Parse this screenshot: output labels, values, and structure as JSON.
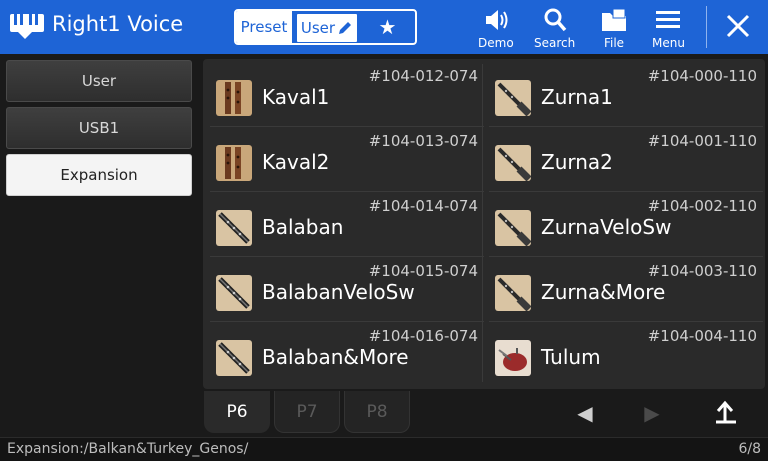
{
  "header": {
    "title": "Right1 Voice",
    "segments": {
      "preset": "Preset",
      "user": "User",
      "favorite": "★"
    },
    "tools": {
      "demo": "Demo",
      "search": "Search",
      "file": "File",
      "menu": "Menu"
    },
    "close": "✕",
    "colors": {
      "bar": "#1e64d6"
    }
  },
  "sidebar": {
    "items": [
      {
        "label": "User"
      },
      {
        "label": "USB1"
      },
      {
        "label": "Expansion"
      }
    ]
  },
  "grid": {
    "left": [
      {
        "code": "#104-012-074",
        "name": "Kaval1",
        "icon": "kaval-icon"
      },
      {
        "code": "#104-013-074",
        "name": "Kaval2",
        "icon": "kaval-icon"
      },
      {
        "code": "#104-014-074",
        "name": "Balaban",
        "icon": "balaban-icon"
      },
      {
        "code": "#104-015-074",
        "name": "BalabanVeloSw",
        "icon": "balaban-icon"
      },
      {
        "code": "#104-016-074",
        "name": "Balaban&More",
        "icon": "balaban-icon"
      }
    ],
    "right": [
      {
        "code": "#104-000-110",
        "name": "Zurna1",
        "icon": "zurna-icon"
      },
      {
        "code": "#104-001-110",
        "name": "Zurna2",
        "icon": "zurna-icon"
      },
      {
        "code": "#104-002-110",
        "name": "ZurnaVeloSw",
        "icon": "zurna-icon"
      },
      {
        "code": "#104-003-110",
        "name": "Zurna&More",
        "icon": "zurna-icon"
      },
      {
        "code": "#104-004-110",
        "name": "Tulum",
        "icon": "tulum-icon"
      }
    ]
  },
  "pages": {
    "p6": "P6",
    "p7": "P7",
    "p8": "P8"
  },
  "nav": {
    "prev": "◀",
    "next": "▶",
    "up": "⮤"
  },
  "status": {
    "path": "Expansion:/Balkan&Turkey_Genos/",
    "count": "6/8"
  }
}
